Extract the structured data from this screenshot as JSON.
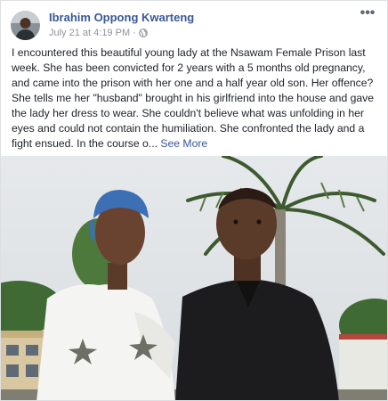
{
  "post": {
    "author": "Ibrahim Oppong Kwarteng",
    "timestamp": "July 21 at 4:19 PM",
    "separator": "·",
    "audience_icon": "globe-icon",
    "more_icon": "more-options-icon",
    "more_label": "•••",
    "text": "I encountered this beautiful young lady at the Nsawam Female Prison last week. She has been convicted for 2 years with a 5 months old pregnancy, and came into the prison with her one and a half year old son. Her offence? She tells me her \"husband\" brought in his girlfriend into the house and gave the lady her dress to wear. She couldn't believe what was unfolding in her eyes and could not contain the humiliation. She confronted the lady and a fight ensued. In the course o...",
    "see_more": "See More"
  },
  "colors": {
    "link": "#385898",
    "text": "#1d2129",
    "meta": "#90949c",
    "border": "#dddfe2"
  }
}
